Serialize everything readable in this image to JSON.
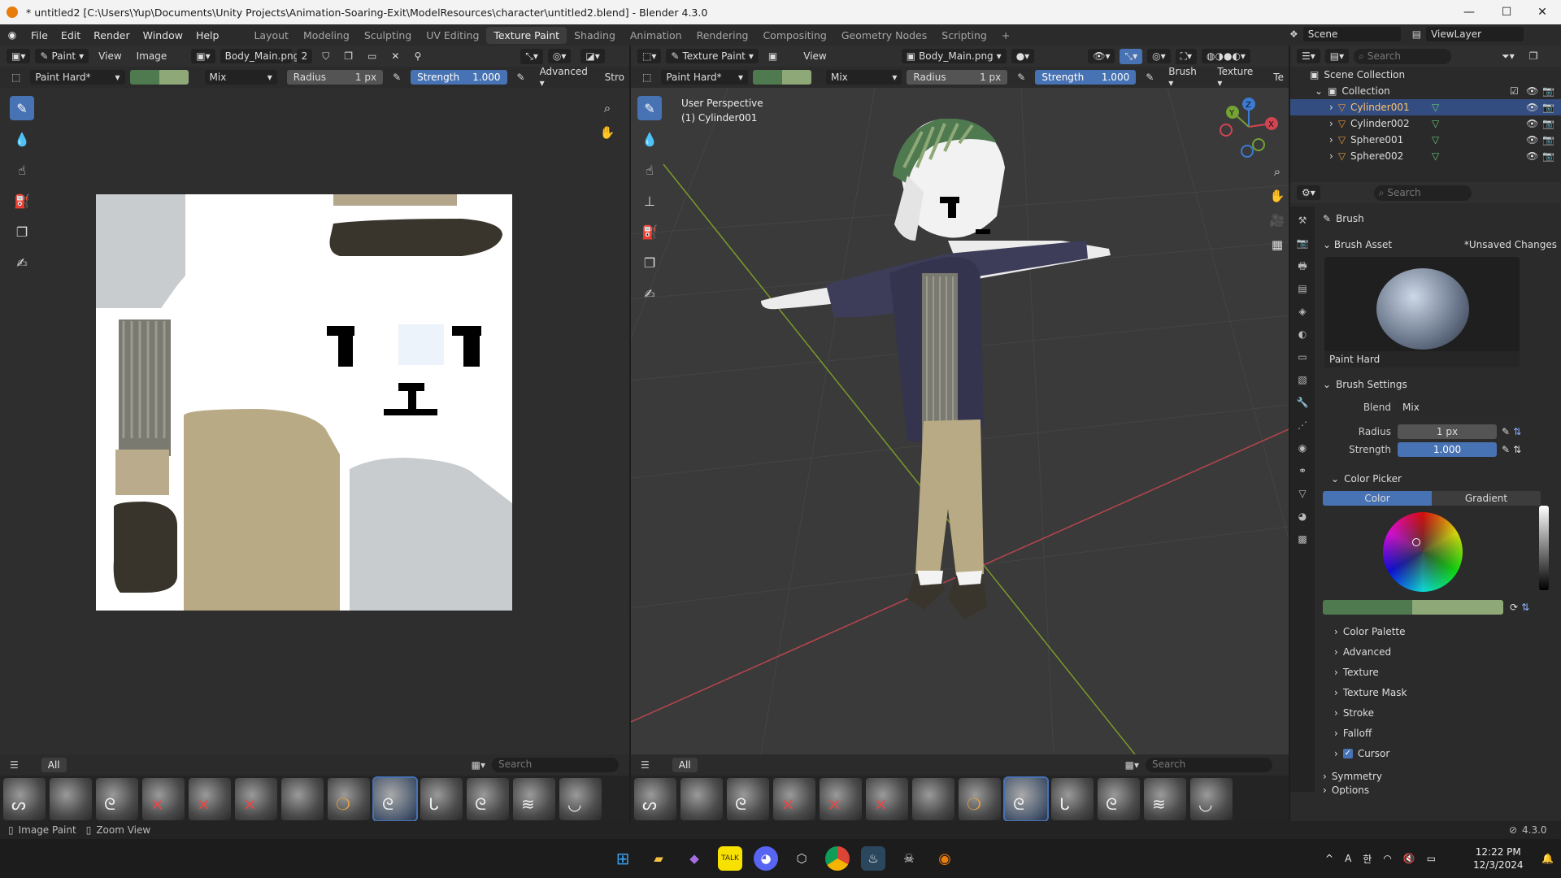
{
  "titlebar": {
    "title": "* untitled2 [C:\\Users\\Yup\\Documents\\Unity Projects\\Animation-Soaring-Exit\\ModelResources\\character\\untitled2.blend] - Blender 4.3.0",
    "minimize": "—",
    "maximize": "☐",
    "close": "✕"
  },
  "menu": [
    "File",
    "Edit",
    "Render",
    "Window",
    "Help"
  ],
  "workspaces": [
    "Layout",
    "Modeling",
    "Sculpting",
    "UV Editing",
    "Texture Paint",
    "Shading",
    "Animation",
    "Rendering",
    "Compositing",
    "Geometry Nodes",
    "Scripting"
  ],
  "active_workspace": "Texture Paint",
  "add_workspace": "+",
  "scene": {
    "label": "Scene",
    "viewlayer": "ViewLayer"
  },
  "image_editor": {
    "mode": "Paint",
    "view": "View",
    "image": "Image",
    "image_name": "Body_Main.png",
    "users": "2",
    "brush": "Paint Hard*",
    "blend": "Mix",
    "radius_label": "Radius",
    "radius_value": "1 px",
    "strength_label": "Strength",
    "strength_value": "1.000",
    "advanced": "Advanced",
    "stroke_trunc": "Stro"
  },
  "viewport": {
    "mode": "Texture Paint",
    "view": "View",
    "image_name": "Body_Main.png",
    "brush": "Paint Hard*",
    "blend": "Mix",
    "radius_label": "Radius",
    "radius_value": "1 px",
    "strength_label": "Strength",
    "strength_value": "1.000",
    "brush_menu": "Brush",
    "texture_menu": "Texture",
    "tex_trunc": "Te",
    "perspective": "User Perspective",
    "object": "(1) Cylinder001",
    "gizmo": {
      "x": "X",
      "y": "Y",
      "z": "Z"
    }
  },
  "colors": {
    "primary": "#4f7a4f",
    "secondary": "#8fa878",
    "accent": "#4772b3"
  },
  "asset_shelf": {
    "tab": "All",
    "search_placeholder": "Search"
  },
  "outliner": {
    "search_placeholder": "Search",
    "root": "Scene Collection",
    "collection": "Collection",
    "items": [
      "Cylinder001",
      "Cylinder002",
      "Sphere001",
      "Sphere002"
    ]
  },
  "properties": {
    "search_placeholder": "Search",
    "header": "Brush",
    "brush_asset": "Brush Asset",
    "unsaved": "*Unsaved Changes",
    "brush_name": "Paint Hard",
    "brush_settings": "Brush Settings",
    "blend_label": "Blend",
    "blend_value": "Mix",
    "radius_label": "Radius",
    "radius_value": "1 px",
    "strength_label": "Strength",
    "strength_value": "1.000",
    "color_picker": "Color Picker",
    "tab_color": "Color",
    "tab_gradient": "Gradient",
    "collapsed": [
      "Color Palette",
      "Advanced",
      "Texture",
      "Texture Mask",
      "Stroke",
      "Falloff",
      "Cursor"
    ],
    "symmetry": "Symmetry",
    "options_trunc": "Options"
  },
  "statusbar": {
    "left1": "Image Paint",
    "left2": "Zoom View",
    "version": "4.3.0"
  },
  "taskbar": {
    "time": "12:22 PM",
    "date": "12/3/2024",
    "tray": [
      "^",
      "A",
      "한"
    ]
  }
}
